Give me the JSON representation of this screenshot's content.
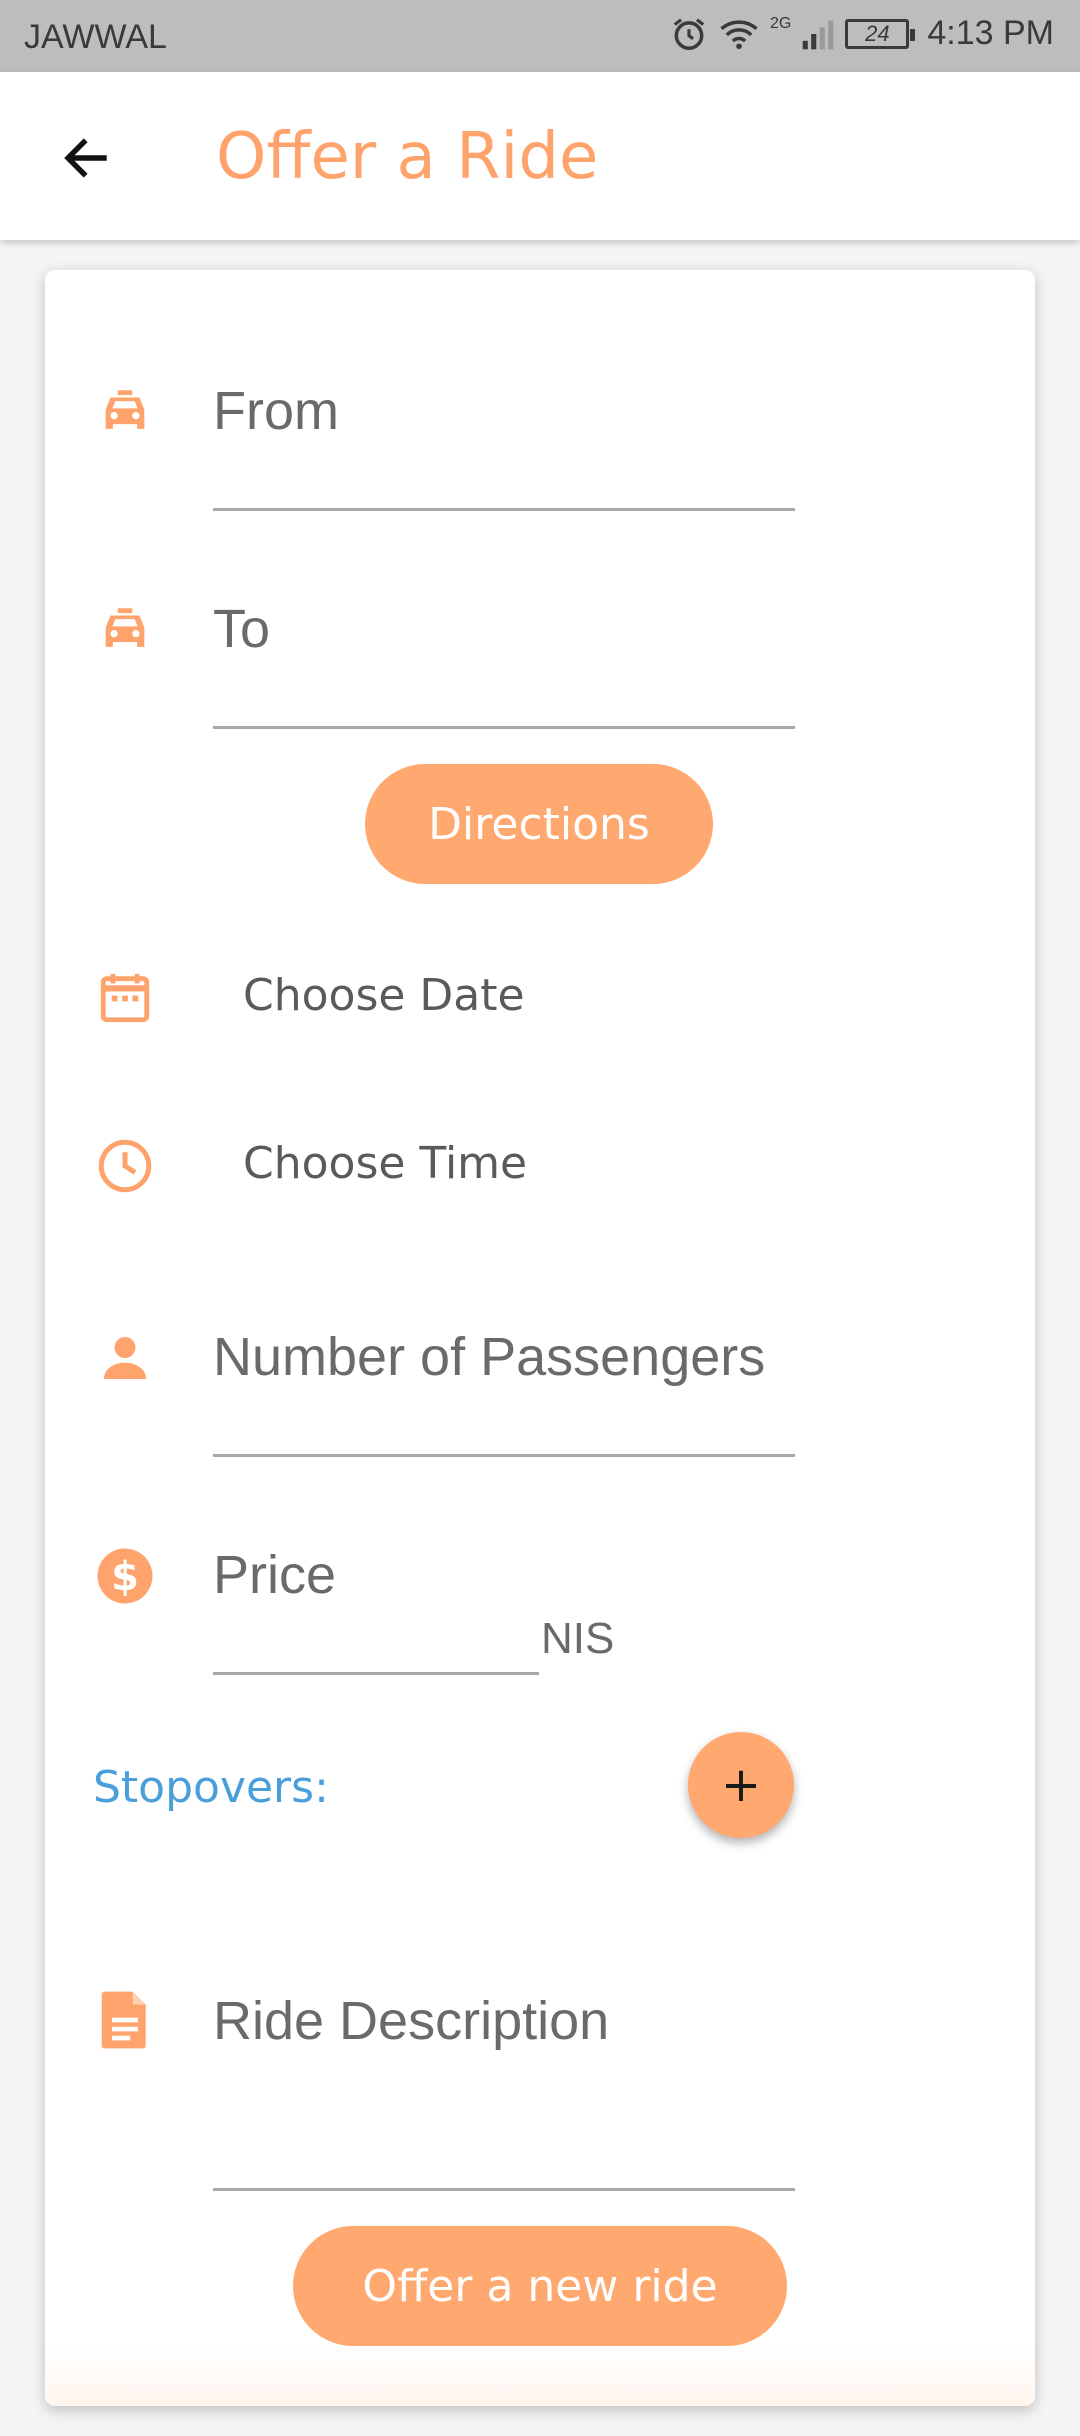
{
  "status_bar": {
    "carrier": "JAWWAL",
    "network": "2G",
    "battery": "24",
    "time": "4:13 PM"
  },
  "app_bar": {
    "title": "Offer a Ride",
    "back_icon": "arrow-back-icon"
  },
  "form": {
    "from_placeholder": "From",
    "to_placeholder": "To",
    "directions_label": "Directions",
    "choose_date_label": "Choose Date",
    "choose_time_label": "Choose Time",
    "passengers_placeholder": "Number of Passengers",
    "price_placeholder": "Price",
    "price_unit": "NIS",
    "stopovers_label": "Stopovers:",
    "add_stopover_label": "+",
    "description_placeholder": "Ride Description",
    "submit_label": "Offer a new ride"
  },
  "icons": {
    "from": "taxi-icon",
    "to": "taxi-icon",
    "date": "calendar-icon",
    "time": "clock-icon",
    "passengers": "person-icon",
    "price": "dollar-icon",
    "description": "document-icon"
  },
  "colors": {
    "accent": "#ffa36c",
    "button": "#ffa86f",
    "stopovers": "#4a9fdb",
    "status_bar": "#bdbdbd"
  }
}
